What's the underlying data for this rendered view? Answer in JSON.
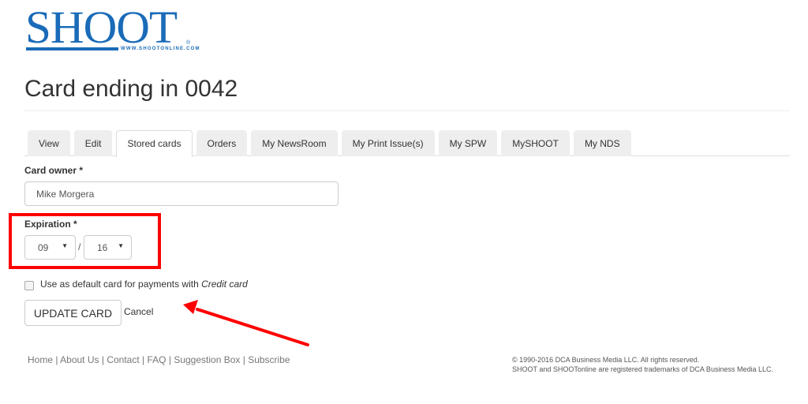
{
  "brand": {
    "logo_text": "SHOOT",
    "logo_url": "WWW.SHOOTONLINE.COM",
    "logo_reg": "®",
    "color": "#1a6bb8"
  },
  "page": {
    "title": "Card ending in 0042"
  },
  "tabs": [
    {
      "label": "View",
      "active": false
    },
    {
      "label": "Edit",
      "active": false
    },
    {
      "label": "Stored cards",
      "active": true
    },
    {
      "label": "Orders",
      "active": false
    },
    {
      "label": "My NewsRoom",
      "active": false
    },
    {
      "label": "My Print Issue(s)",
      "active": false
    },
    {
      "label": "My SPW",
      "active": false
    },
    {
      "label": "MySHOOT",
      "active": false
    },
    {
      "label": "My NDS",
      "active": false
    }
  ],
  "form": {
    "card_owner": {
      "label": "Card owner",
      "required_mark": "*",
      "value": "Mike Morgera"
    },
    "expiration": {
      "label": "Expiration",
      "required_mark": "*",
      "month": "09",
      "separator": "/",
      "year": "16",
      "caret": "▼"
    },
    "default_card": {
      "label_prefix": "Use as default card for payments with ",
      "label_emphasis": "Credit card",
      "checked": false
    },
    "update_button": "UPDATE CARD",
    "cancel_link": "Cancel"
  },
  "annotations": {
    "highlight_color": "#ff0000",
    "arrow_color": "#ff0000"
  },
  "footer": {
    "links": [
      "Home",
      "About Us",
      "Contact",
      "FAQ",
      "Suggestion Box",
      "Subscribe"
    ],
    "separator": "|",
    "copyright_line1": "© 1990-2016 DCA Business Media LLC. All rights reserved.",
    "copyright_line2": "SHOOT and SHOOTonline are registered trademarks of DCA Business Media LLC."
  }
}
